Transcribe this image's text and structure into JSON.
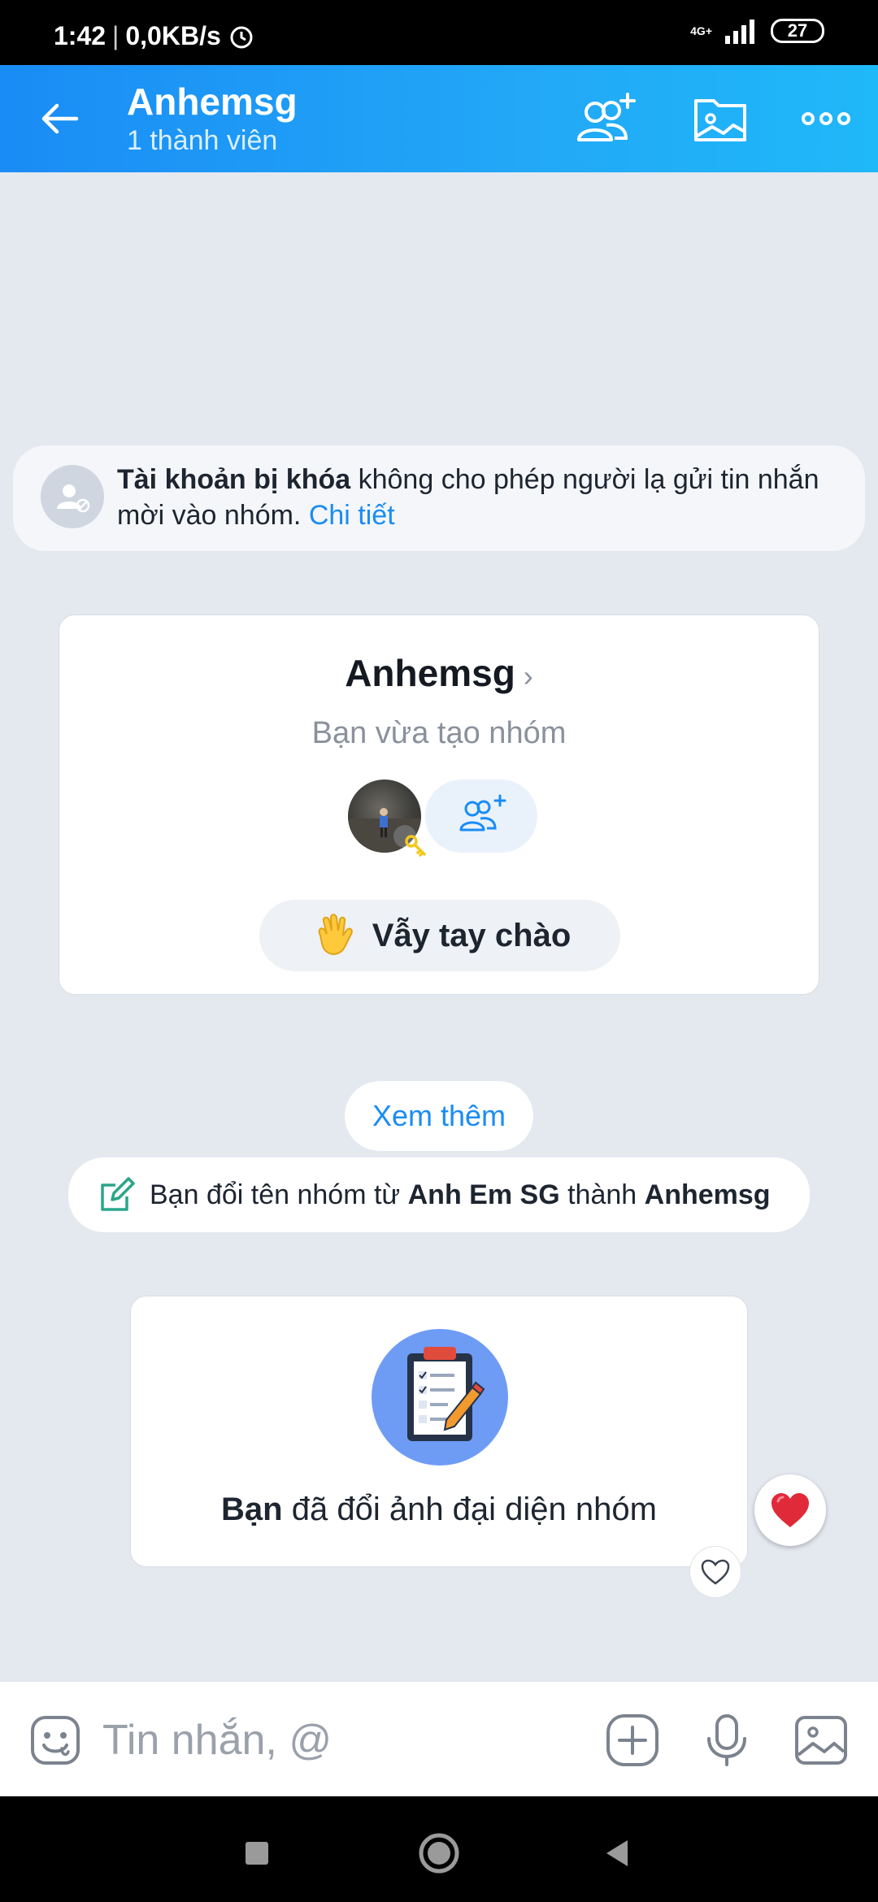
{
  "status_bar": {
    "time": "1:42",
    "speed": "0,0KB/s",
    "network": "4G+",
    "battery": "27"
  },
  "header": {
    "title": "Anhemsg",
    "subtitle": "1 thành viên"
  },
  "banner": {
    "bold": "Tài khoản bị khóa",
    "text": " không cho phép người lạ gửi tin nhắn mời vào nhóm. ",
    "link": "Chi tiết"
  },
  "group_card": {
    "name": "Anhemsg",
    "chevron": "›",
    "subtitle": "Bạn vừa tạo nhóm",
    "wave_label": "Vẫy tay chào"
  },
  "see_more": "Xem thêm",
  "rename_event": {
    "prefix": "Bạn đổi tên nhóm từ ",
    "old_name": "Anh Em SG",
    "middle": " thành ",
    "new_name": "Anhemsg"
  },
  "photo_event": {
    "actor": "Bạn",
    "text": " đã đổi ảnh đại diện nhóm"
  },
  "composer": {
    "placeholder": "Tin nhắn, @"
  },
  "colors": {
    "brand_blue": "#1a8cf5",
    "background": "#e4e8ef",
    "reaction_red": "#e02a3a"
  },
  "icons": [
    "back-arrow-icon",
    "add-member-icon",
    "gallery-icon",
    "more-icon",
    "sticker-icon",
    "plus-icon",
    "mic-icon",
    "image-icon",
    "heart-icon"
  ]
}
